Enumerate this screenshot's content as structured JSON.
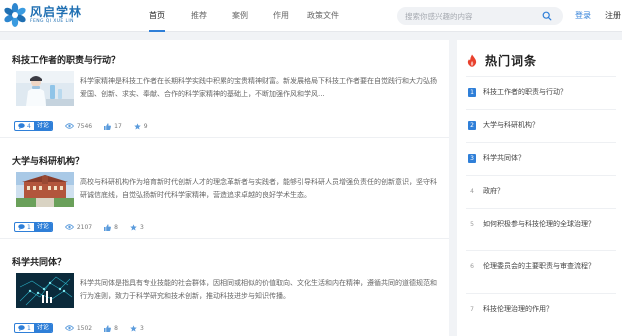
{
  "header": {
    "logo_cn": "风启学林",
    "logo_en": "FENG QI XUE LIN",
    "nav": [
      "首页",
      "推荐",
      "案例",
      "作用",
      "政策文件"
    ],
    "search_placeholder": "搜索你感兴趣的内容",
    "login": "登录",
    "register": "注册"
  },
  "articles": [
    {
      "title": "科技工作者的职责与行动？",
      "summary": "科学家精神是科技工作者在长期科学实践中积累的宝贵精神财富。新发展格局下科技工作者要在自觉践行和大力弘扬爱国、创新、求实、奉献、合作的科学家精神的基础上，不断加强作风和学风...",
      "comments": "4",
      "comment_label": "讨论",
      "views": "7546",
      "likes": "17",
      "stars": "9"
    },
    {
      "title": "大学与科研机构？",
      "summary": "高校与科研机构作为培育新时代创新人才的理念革新者与实践者，能够引导科研人员增强负责任的创新意识，坚守科研诚信底线，自觉弘扬新时代科学家精神，营造追求卓越的良好学术生态。",
      "comments": "1",
      "comment_label": "讨论",
      "views": "2107",
      "likes": "8",
      "stars": "3"
    },
    {
      "title": "科学共同体？",
      "summary": "科学共同体是指具有专业技能的社会群体，因相同或相似的价值取向、文化生活和内在精神，遵循共同的道德规范和行为准则，致力于科学研究和技术创新，推动科技进步与知识传播。",
      "comments": "1",
      "comment_label": "讨论",
      "views": "1502",
      "likes": "8",
      "stars": "3"
    }
  ],
  "sidebar": {
    "title": "热门词条",
    "items": [
      {
        "rank": "1",
        "text": "科技工作者的职责与行动？"
      },
      {
        "rank": "2",
        "text": "大学与科研机构？"
      },
      {
        "rank": "3",
        "text": "科学共同体？"
      },
      {
        "rank": "4",
        "text": "政府？"
      },
      {
        "rank": "5",
        "text": "如何积极参与科技伦理的全球治理？"
      },
      {
        "rank": "6",
        "text": "伦理委员会的主要职责与审查流程？"
      },
      {
        "rank": "7",
        "text": "科技伦理治理的作用？"
      }
    ]
  },
  "colors": {
    "accent": "#2f7fd8",
    "logo": "#1f6fb2",
    "hot": "#e8402c"
  }
}
